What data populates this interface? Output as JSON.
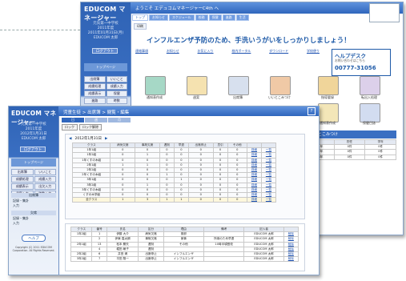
{
  "back": {
    "logo": "EDUCOM マネージャー",
    "school": "元気第一中学校",
    "year": "2011年度",
    "date": "2011年01月31日(月)",
    "user": "EDUCOM 太郎",
    "logout": "ログアウト",
    "side_title": "トップページ",
    "side_items": [
      "出席簿",
      "いいこと",
      "成績処理",
      "成績入力",
      "成績表示",
      "保健",
      "進路",
      "時数"
    ],
    "header": "ようこそ エデュコムマネージャーC4th へ",
    "tabs": [
      "トップ",
      "お知らせ",
      "スケジュール",
      "校務",
      "保健",
      "進路",
      "生活"
    ],
    "sub": "印刷",
    "banner": "インフルエンザ予防のため、手洗いうがいをしっかりしましょう！",
    "links": [
      "連絡事項",
      "お知らせ",
      "お気に入り",
      "校内ポータル",
      "ダウンロード",
      "学校便り"
    ],
    "icons": [
      "通知表作成",
      "週案",
      "出席簿",
      "いいとこみつけ",
      "指導要録",
      "転出入処理"
    ],
    "icons2": [
      "通知表作成",
      "保健日誌"
    ],
    "help_title": "ヘルプデスク",
    "help_sub": "お問い合わせはこちら",
    "help_phone": "00777-31056",
    "panel": "いいとこみつけ",
    "panel_cols": [
      "",
      "担任",
      "学年"
    ],
    "panel_rows": [
      [
        "1年",
        "0件",
        "0件"
      ],
      [
        "2年",
        "0件",
        "0件"
      ],
      [
        "3年",
        "0件",
        "0件"
      ]
    ]
  },
  "front": {
    "logo": "EDUCOM マネージャー",
    "school": "元気第一中学校",
    "year": "2011年度",
    "date": "2012年1月31日",
    "user": "EDUCOM 太郎",
    "logout": "ログアウト",
    "menu_title": "トップページ",
    "menu_btns": [
      "出席簿",
      "いいこと",
      "成績処理",
      "成績入力",
      "成績表示",
      "出欠入力",
      "週案入力",
      "時数入力"
    ],
    "menu2": "出席簿",
    "menu3": [
      "記録・集計",
      "入力"
    ],
    "menu4": "欠席",
    "menu5": [
      "記録・集計",
      "入力"
    ],
    "help": "ヘルプ",
    "copyright": "Copyright (C) 2011 EDUCOM Corporation. All Rights Reserved.",
    "title": "児童生徒 > 出席簿 > 閲覧・編集",
    "tabs": [
      "日",
      "週",
      "月"
    ],
    "buttons": [
      "ロック",
      "ロック解除"
    ],
    "cols": [
      "クラス",
      "病気欠席",
      "事故欠席",
      "遅刻",
      "早退",
      "出席停止",
      "忌引",
      "その他",
      "",
      ""
    ],
    "rows": [
      [
        "1年1組",
        "0",
        "0",
        "0",
        "0",
        "0",
        "0",
        "0",
        "詳細",
        "一覧"
      ],
      [
        "1年2組",
        "0",
        "1",
        "0",
        "0",
        "0",
        "0",
        "0",
        "詳細",
        "一覧"
      ],
      [
        "1年くすの木組",
        "0",
        "0",
        "0",
        "0",
        "0",
        "0",
        "0",
        "詳細",
        "一覧"
      ],
      [
        "2年1組",
        "1",
        "1",
        "0",
        "0",
        "0",
        "0",
        "0",
        "詳細",
        "一覧"
      ],
      [
        "2年2組",
        "0",
        "0",
        "0",
        "0",
        "0",
        "0",
        "0",
        "詳細",
        "一覧"
      ],
      [
        "2年くすの木組",
        "0",
        "0",
        "1",
        "0",
        "0",
        "0",
        "0",
        "詳細",
        "一覧"
      ],
      [
        "3年1組",
        "0",
        "0",
        "0",
        "1",
        "0",
        "0",
        "0",
        "詳細",
        "一覧"
      ],
      [
        "3年2組",
        "0",
        "1",
        "0",
        "0",
        "0",
        "0",
        "0",
        "詳細",
        "一覧"
      ],
      [
        "3年くすの木組",
        "0",
        "0",
        "0",
        "0",
        "0",
        "0",
        "0",
        "詳細",
        "一覧"
      ],
      [
        "くすの木学級",
        "0",
        "0",
        "0",
        "0",
        "0",
        "0",
        "0",
        "詳細",
        "一覧"
      ],
      [
        "全クラス",
        "1",
        "3",
        "1",
        "1",
        "0",
        "0",
        "0",
        "詳細",
        "一覧"
      ]
    ],
    "cols2": [
      "クラス",
      "番号",
      "氏名",
      "区分",
      "理由",
      "備考",
      "記入者",
      ""
    ],
    "rows2": [
      [
        "1年2組",
        "1",
        "伊藤 大介",
        "病気欠席",
        "風邪",
        "",
        "EDUCOM 太郎",
        "削除"
      ],
      [
        "",
        "2",
        "伊東 嘉太朗",
        "事故欠席",
        "家事",
        "所用のため早退",
        "EDUCOM 太郎",
        "削除"
      ],
      [
        "2年1組",
        "13",
        "松本 勝矢",
        "遅刻",
        "その他",
        "10時半頃登校",
        "EDUCOM 太郎",
        "削除"
      ],
      [
        "",
        "4",
        "堀田 綾子",
        "遅刻",
        "",
        "",
        "EDUCOM 太郎",
        "削除"
      ],
      [
        "2年2組",
        "6",
        "井田 満",
        "出席停止",
        "インフルエンザ",
        "",
        "EDUCOM 太郎",
        "削除"
      ],
      [
        "3年2組",
        "7",
        "平田 翔一",
        "出席停止",
        "インフルエンザ",
        "",
        "EDUCOM 太郎",
        "削除"
      ]
    ]
  },
  "colors": {
    "blue": "#2f66bd",
    "accent": "#1e5aa8"
  }
}
